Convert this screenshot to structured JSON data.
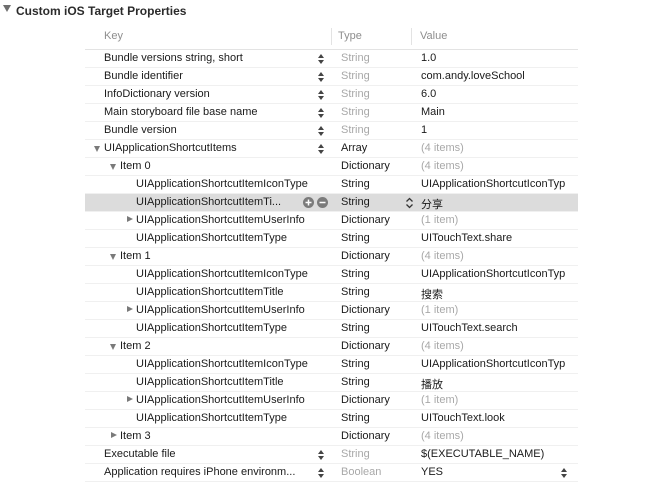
{
  "section": {
    "title": "Custom iOS Target Properties"
  },
  "columns": {
    "key": "Key",
    "type": "Type",
    "value": "Value"
  },
  "rows": [
    {
      "key": "Bundle versions string, short",
      "type": "String",
      "value": "1.0",
      "type_gray": true,
      "value_gray": false
    },
    {
      "key": "Bundle identifier",
      "type": "String",
      "value": "com.andy.loveSchool",
      "type_gray": true,
      "value_gray": false
    },
    {
      "key": "InfoDictionary version",
      "type": "String",
      "value": "6.0",
      "type_gray": true,
      "value_gray": false
    },
    {
      "key": "Main storyboard file base name",
      "type": "String",
      "value": "Main",
      "type_gray": true,
      "value_gray": false
    },
    {
      "key": "Bundle version",
      "type": "String",
      "value": "1",
      "type_gray": true,
      "value_gray": false
    },
    {
      "key": "UIApplicationShortcutItems",
      "type": "Array",
      "value": "(4 items)",
      "type_gray": false,
      "value_gray": true
    },
    {
      "key": "Item 0",
      "type": "Dictionary",
      "value": "(4 items)",
      "type_gray": false,
      "value_gray": true
    },
    {
      "key": "UIApplicationShortcutItemIconType",
      "type": "String",
      "value": "UIApplicationShortcutIconTyp",
      "type_gray": false,
      "value_gray": false
    },
    {
      "key": "UIApplicationShortcutItemTi...",
      "type": "String",
      "value": "分享",
      "type_gray": false,
      "value_gray": false
    },
    {
      "key": "UIApplicationShortcutItemUserInfo",
      "type": "Dictionary",
      "value": "(1 item)",
      "type_gray": false,
      "value_gray": true
    },
    {
      "key": "UIApplicationShortcutItemType",
      "type": "String",
      "value": "UITouchText.share",
      "type_gray": false,
      "value_gray": false
    },
    {
      "key": "Item 1",
      "type": "Dictionary",
      "value": "(4 items)",
      "type_gray": false,
      "value_gray": true
    },
    {
      "key": "UIApplicationShortcutItemIconType",
      "type": "String",
      "value": "UIApplicationShortcutIconTyp",
      "type_gray": false,
      "value_gray": false
    },
    {
      "key": "UIApplicationShortcutItemTitle",
      "type": "String",
      "value": "搜索",
      "type_gray": false,
      "value_gray": false
    },
    {
      "key": "UIApplicationShortcutItemUserInfo",
      "type": "Dictionary",
      "value": "(1 item)",
      "type_gray": false,
      "value_gray": true
    },
    {
      "key": "UIApplicationShortcutItemType",
      "type": "String",
      "value": "UITouchText.search",
      "type_gray": false,
      "value_gray": false
    },
    {
      "key": "Item 2",
      "type": "Dictionary",
      "value": "(4 items)",
      "type_gray": false,
      "value_gray": true
    },
    {
      "key": "UIApplicationShortcutItemIconType",
      "type": "String",
      "value": "UIApplicationShortcutIconTyp",
      "type_gray": false,
      "value_gray": false
    },
    {
      "key": "UIApplicationShortcutItemTitle",
      "type": "String",
      "value": "播放",
      "type_gray": false,
      "value_gray": false
    },
    {
      "key": "UIApplicationShortcutItemUserInfo",
      "type": "Dictionary",
      "value": "(1 item)",
      "type_gray": false,
      "value_gray": true
    },
    {
      "key": "UIApplicationShortcutItemType",
      "type": "String",
      "value": "UITouchText.look",
      "type_gray": false,
      "value_gray": false
    },
    {
      "key": "Item 3",
      "type": "Dictionary",
      "value": "(4 items)",
      "type_gray": false,
      "value_gray": true
    },
    {
      "key": "Executable file",
      "type": "String",
      "value": "$(EXECUTABLE_NAME)",
      "type_gray": true,
      "value_gray": false
    },
    {
      "key": "Application requires iPhone environm...",
      "type": "Boolean",
      "value": "YES",
      "type_gray": true,
      "value_gray": false
    }
  ],
  "icons": {
    "section_toggle": "disclosure-triangle-icon",
    "add": "plus-circle-icon",
    "remove": "minus-circle-icon",
    "stepper": "up-down-stepper-icon",
    "expand": "disclosure-triangle-icon"
  },
  "colors": {
    "selected_row": "#dcdcdc",
    "muted_text": "#a8a8a8",
    "header_text": "#8e8e8e"
  }
}
